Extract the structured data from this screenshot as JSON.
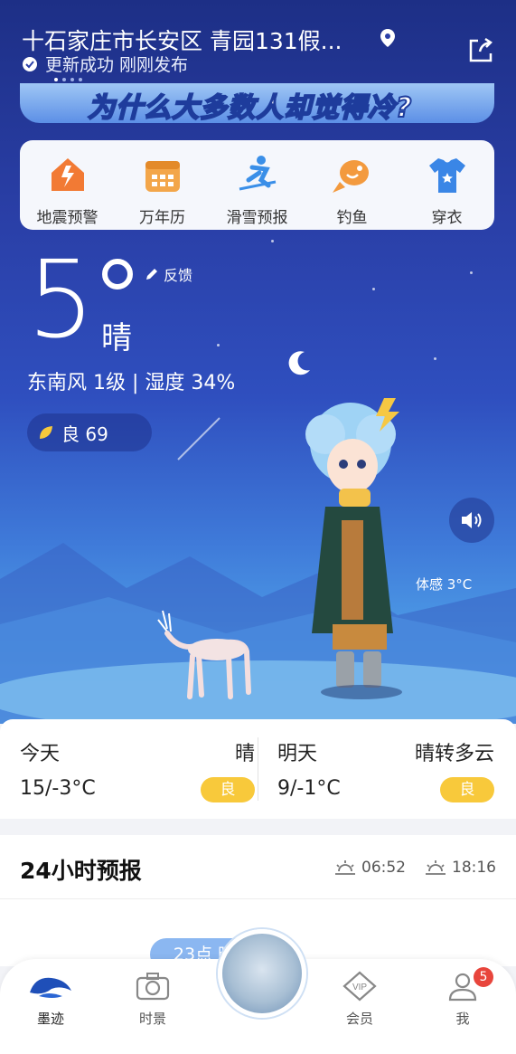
{
  "header": {
    "location": "十石家庄市长安区 青园131假...",
    "update_status": "更新成功 刚刚发布",
    "banner_text": "为什么大多数人却觉得冷?"
  },
  "tools": [
    {
      "label": "地震预警",
      "icon": "house-alert-icon"
    },
    {
      "label": "万年历",
      "icon": "calendar-icon"
    },
    {
      "label": "滑雪预报",
      "icon": "skier-icon"
    },
    {
      "label": "钓鱼",
      "icon": "fish-icon"
    },
    {
      "label": "穿衣",
      "icon": "tshirt-icon"
    }
  ],
  "current": {
    "temp": "5",
    "condition": "晴",
    "feedback": "反馈",
    "wind_humidity": "东南风 1级 | 湿度 34%",
    "aqi": "良 69",
    "feels_like": "体感 3°C"
  },
  "forecast": {
    "today": {
      "name": "今天",
      "condition": "晴",
      "temp": "15/-3°C",
      "quality": "良"
    },
    "tomorrow": {
      "name": "明天",
      "condition": "晴转多云",
      "temp": "9/-1°C",
      "quality": "良"
    }
  },
  "hourly": {
    "title": "24小时预报",
    "sunrise": "06:52",
    "sunset": "18:16",
    "pill": "23点 晴"
  },
  "tabbar": {
    "items": [
      {
        "label": "墨迹"
      },
      {
        "label": "时景"
      },
      {
        "label": "会员"
      },
      {
        "label": "我"
      }
    ],
    "badge": "5"
  },
  "colors": {
    "accent": "#f8c93b",
    "sky_top": "#1d2f86",
    "badge": "#e8453c"
  }
}
